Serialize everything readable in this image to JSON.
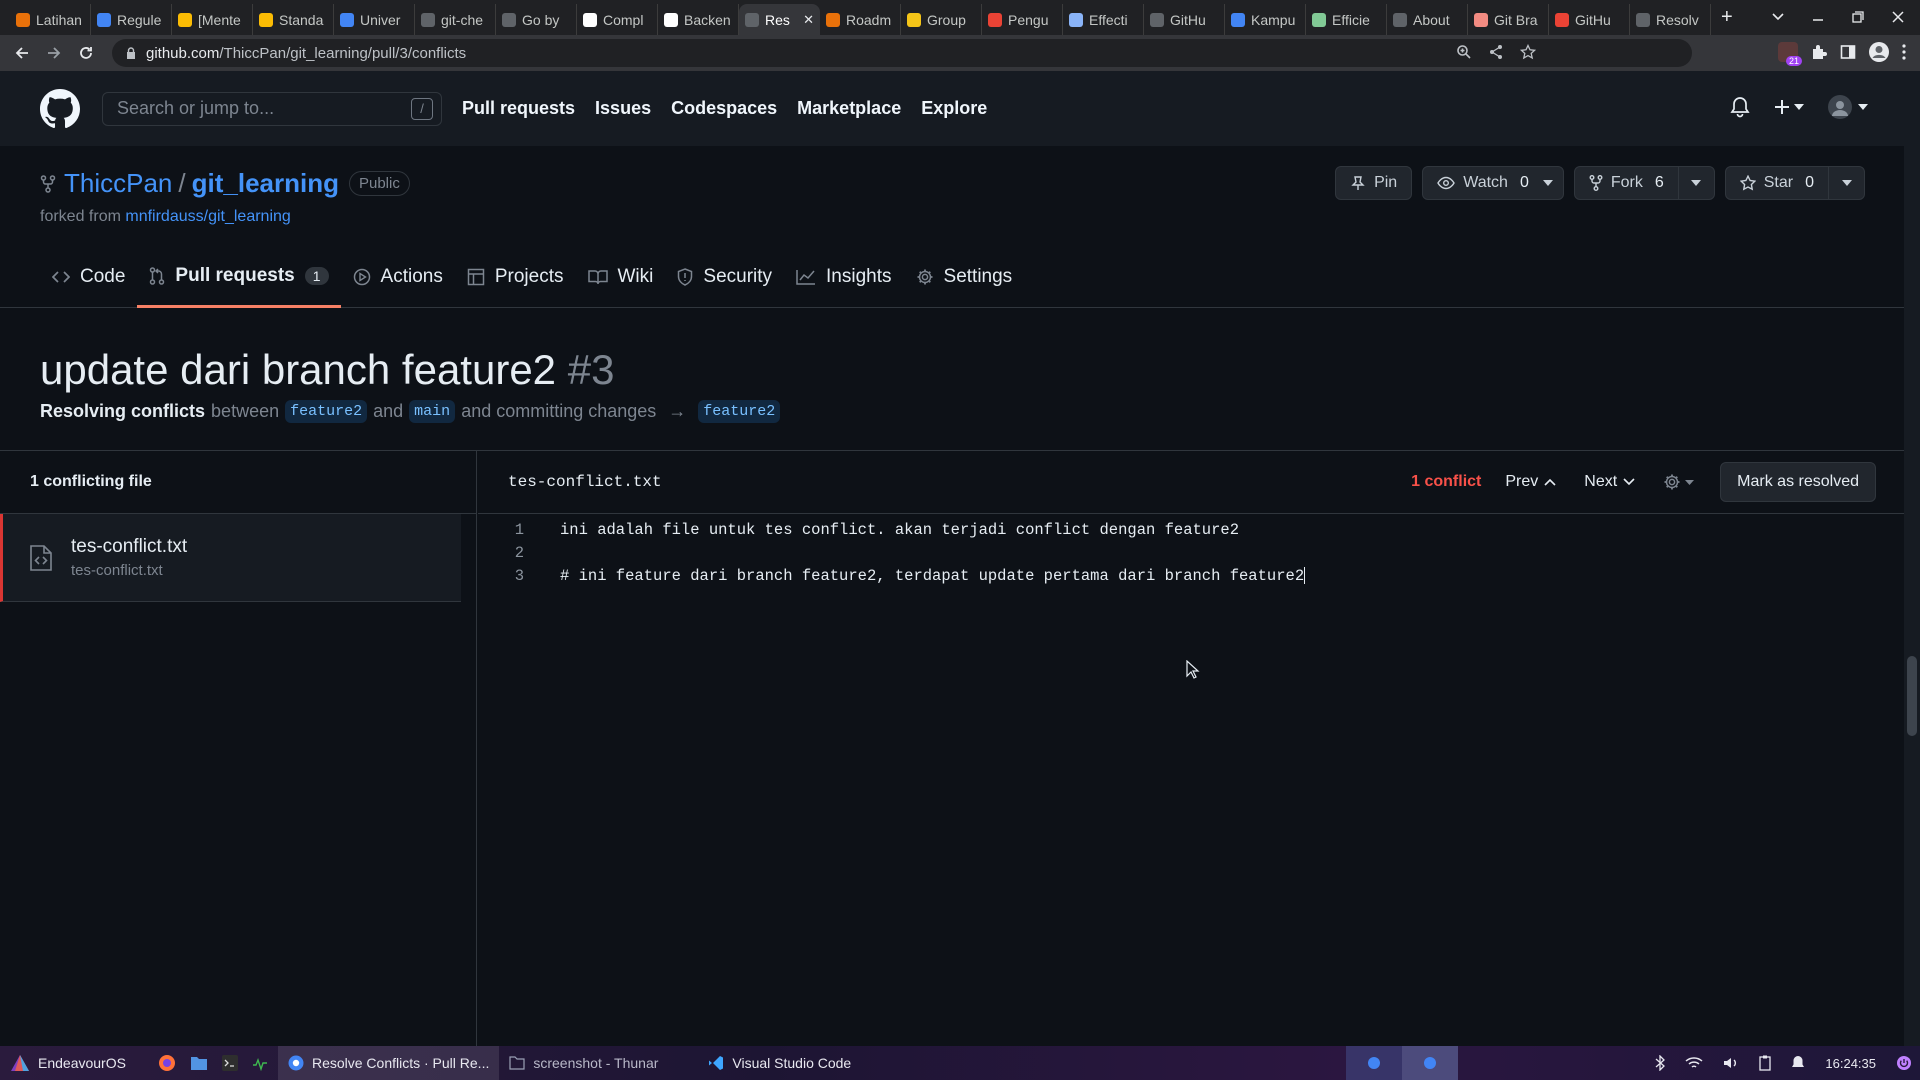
{
  "browser": {
    "tabs": [
      {
        "label": "Latihan",
        "color": "#e8710a"
      },
      {
        "label": "Regule",
        "color": "#4285f4"
      },
      {
        "label": "[Mente",
        "color": "#fbbc04"
      },
      {
        "label": "Standa",
        "color": "#fbbc04"
      },
      {
        "label": "Univer",
        "color": "#4285f4"
      },
      {
        "label": "git-che",
        "color": "#5f6368"
      },
      {
        "label": "Go by",
        "color": "#5f6368"
      },
      {
        "label": "Compl",
        "color": "#ffffff"
      },
      {
        "label": "Backen",
        "color": "#ffffff"
      },
      {
        "label": "Res",
        "color": "#5f6368",
        "active": true
      },
      {
        "label": "Roadm",
        "color": "#e8710a"
      },
      {
        "label": "Group",
        "color": "#f5c518"
      },
      {
        "label": "Pengu",
        "color": "#ea4335"
      },
      {
        "label": "Effecti",
        "color": "#8ab4f8"
      },
      {
        "label": "GitHu",
        "color": "#5f6368"
      },
      {
        "label": "Kampu",
        "color": "#4285f4"
      },
      {
        "label": "Efficie",
        "color": "#81c995"
      },
      {
        "label": "About",
        "color": "#5f6368"
      },
      {
        "label": "Git Bra",
        "color": "#f28b82"
      },
      {
        "label": "GitHu",
        "color": "#ea4335"
      },
      {
        "label": "Resolv",
        "color": "#5f6368"
      }
    ],
    "new_tab": "+",
    "address": {
      "host": "github.com",
      "path": "/ThiccPan/git_learning/pull/3/conflicts"
    }
  },
  "github": {
    "search_placeholder": "Search or jump to...",
    "search_key": "/",
    "nav": [
      "Pull requests",
      "Issues",
      "Codespaces",
      "Marketplace",
      "Explore"
    ]
  },
  "repo": {
    "owner": "ThiccPan",
    "separator": "/",
    "name": "git_learning",
    "visibility": "Public",
    "forked_prefix": "forked from",
    "forked_from": "mnfirdauss/git_learning",
    "pin_label": "Pin",
    "watch_label": "Watch",
    "watch_count": "0",
    "fork_label": "Fork",
    "fork_count": "6",
    "star_label": "Star",
    "star_count": "0",
    "tabs": [
      {
        "label": "Code",
        "icon": "code-icon"
      },
      {
        "label": "Pull requests",
        "icon": "pull-request-icon",
        "count": "1",
        "active": true
      },
      {
        "label": "Actions",
        "icon": "play-icon"
      },
      {
        "label": "Projects",
        "icon": "table-icon"
      },
      {
        "label": "Wiki",
        "icon": "book-icon"
      },
      {
        "label": "Security",
        "icon": "shield-icon"
      },
      {
        "label": "Insights",
        "icon": "graph-icon"
      },
      {
        "label": "Settings",
        "icon": "gear-icon"
      }
    ]
  },
  "pr": {
    "title": "update dari branch feature2",
    "number": "#3",
    "sub_bold": "Resolving conflicts",
    "sub_between": "between",
    "head_branch": "feature2",
    "sub_and": "and",
    "base_branch": "main",
    "sub_commit": "and committing changes",
    "arrow": "→",
    "target_branch": "feature2"
  },
  "resolver": {
    "sidebar_title": "1 conflicting file",
    "file": {
      "name": "tes-conflict.txt",
      "path": "tes-conflict.txt"
    },
    "editor_file": "tes-conflict.txt",
    "conflict_count": "1 conflict",
    "prev_label": "Prev",
    "next_label": "Next",
    "mark_resolved": "Mark as resolved",
    "lines": [
      {
        "n": "1",
        "text": "ini adalah file untuk tes conflict. akan terjadi conflict dengan feature2"
      },
      {
        "n": "2",
        "text": ""
      },
      {
        "n": "3",
        "text": "# ini feature dari branch feature2, terdapat update pertama dari branch feature2"
      }
    ]
  },
  "taskbar": {
    "start": "EndeavourOS",
    "windows": [
      {
        "label": "Resolve Conflicts · Pull Re...",
        "active": true
      },
      {
        "label": "screenshot - Thunar"
      },
      {
        "label": "Visual Studio Code"
      }
    ],
    "clock": "16:24:35"
  },
  "colors": {
    "accent": "#f78166",
    "link": "#4493f8",
    "conflict": "#f85149"
  }
}
